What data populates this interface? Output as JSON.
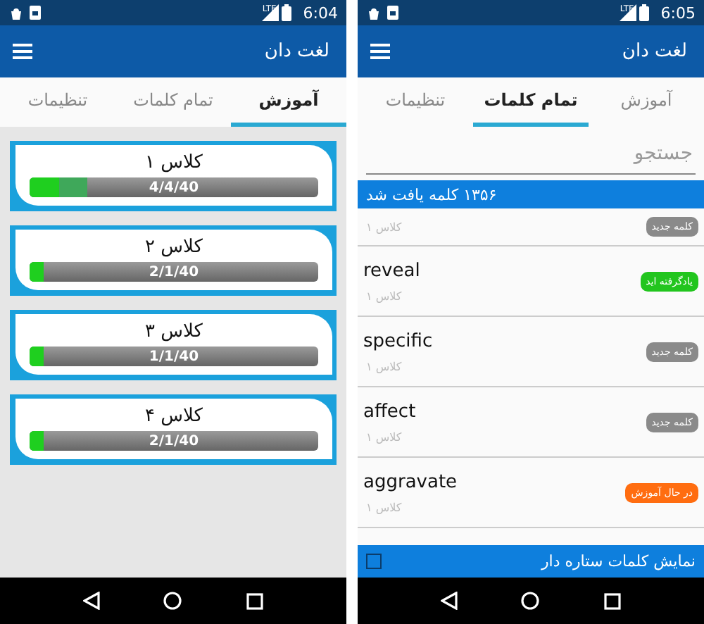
{
  "screens": [
    {
      "status_bar": {
        "time": "6:05",
        "network": "LTE"
      },
      "app_bar": {
        "title": "لغت دان"
      },
      "tabs": [
        {
          "label": "آموزش",
          "selected": false
        },
        {
          "label": "تمام کلمات",
          "selected": true
        },
        {
          "label": "تنظیمات",
          "selected": false
        }
      ],
      "kind": "words",
      "search": {
        "placeholder": "جستجو"
      },
      "result_banner": "۱۳۵۶ کلمه یافت شد",
      "words": [
        {
          "class": "کلاس ۱",
          "status": "کلمه جدید",
          "kind": "new"
        },
        {
          "word": "reveal",
          "class": "کلاس ۱",
          "status": "یادگرفته اید",
          "kind": "learned"
        },
        {
          "word": "specific",
          "class": "کلاس ۱",
          "status": "کلمه جدید",
          "kind": "new"
        },
        {
          "word": "affect",
          "class": "کلاس ۱",
          "status": "کلمه جدید",
          "kind": "new"
        },
        {
          "word": "aggravate",
          "class": "کلاس ۱",
          "status": "در حال آموزش",
          "kind": "learning"
        }
      ],
      "starred_filter": {
        "label": "نمایش کلمات ستاره دار",
        "checked": false
      }
    },
    {
      "status_bar": {
        "time": "6:04",
        "network": "LTE"
      },
      "app_bar": {
        "title": "لغت دان"
      },
      "tabs": [
        {
          "label": "آموزش",
          "selected": true
        },
        {
          "label": "تمام کلمات",
          "selected": false
        },
        {
          "label": "تنظیمات",
          "selected": false
        }
      ],
      "kind": "classes",
      "classes": [
        {
          "title": "کلاس ۱",
          "progress": "4/4/40",
          "learned": {
            "level": 0.1
          },
          "learning": {
            "level": 0.2
          }
        },
        {
          "title": "کلاس ۲",
          "progress": "2/1/40",
          "learned": {
            "level": 0.05
          },
          "learning": {
            "level": 0.05
          }
        },
        {
          "title": "کلاس ۳",
          "progress": "1/1/40",
          "learned": {
            "level": 0.05
          },
          "learning": {
            "level": 0.05
          }
        },
        {
          "title": "کلاس ۴",
          "progress": "2/1/40",
          "learned": {
            "level": 0.05
          },
          "learning": {
            "level": 0.05
          }
        }
      ]
    }
  ]
}
